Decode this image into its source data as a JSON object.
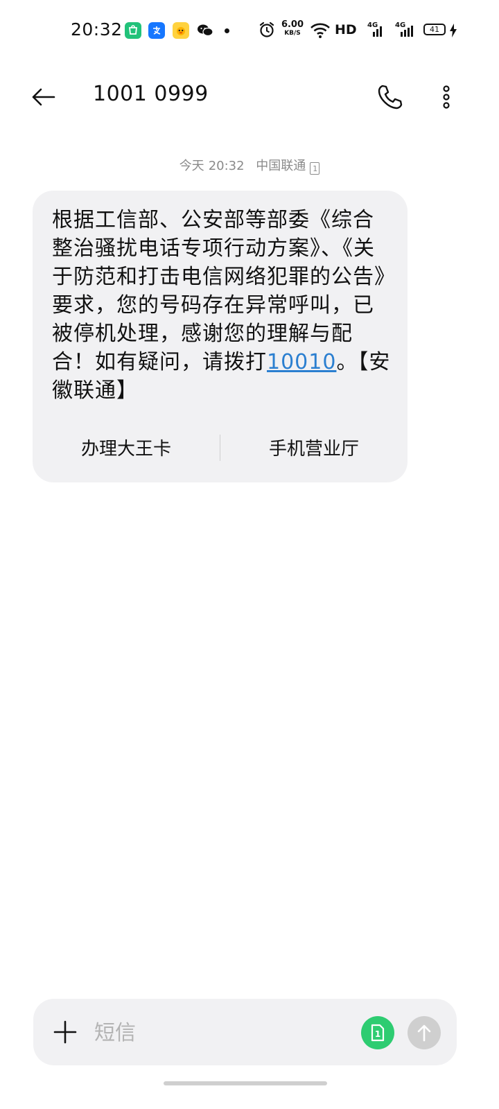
{
  "status_bar": {
    "time": "20:32",
    "net_speed_value": "6.00",
    "net_speed_unit": "KB/S",
    "hd_label": "HD",
    "sig1_label": "4G",
    "sig2_label": "4G",
    "battery_level": "41",
    "apps": [
      "app-store-icon",
      "alipay-icon",
      "duck-app-icon",
      "wechat-icon"
    ]
  },
  "header": {
    "title": "1001 0999"
  },
  "meta": {
    "day": "今天",
    "time": "20:32",
    "carrier": "中国联通",
    "sim_slot": "1"
  },
  "message": {
    "body_prefix": "根据工信部、公安部等部委《综合整治骚扰电话专项行动方案》、《关于防范和打击电信网络犯罪的公告》要求，您的号码存在异常呼叫，已被停机处理，感谢您的理解与配合！如有疑问，请拨打",
    "link_number": "10010",
    "body_suffix": "。【安徽联通】",
    "actions": [
      "办理大王卡",
      "手机营业厅"
    ]
  },
  "composer": {
    "placeholder": "短信",
    "sim_slot": "1"
  },
  "colors": {
    "link": "#2b7fd0",
    "sim_button": "#2ecc71",
    "send_button_disabled": "#cfcfcf",
    "bubble_bg": "#f1f1f3"
  }
}
